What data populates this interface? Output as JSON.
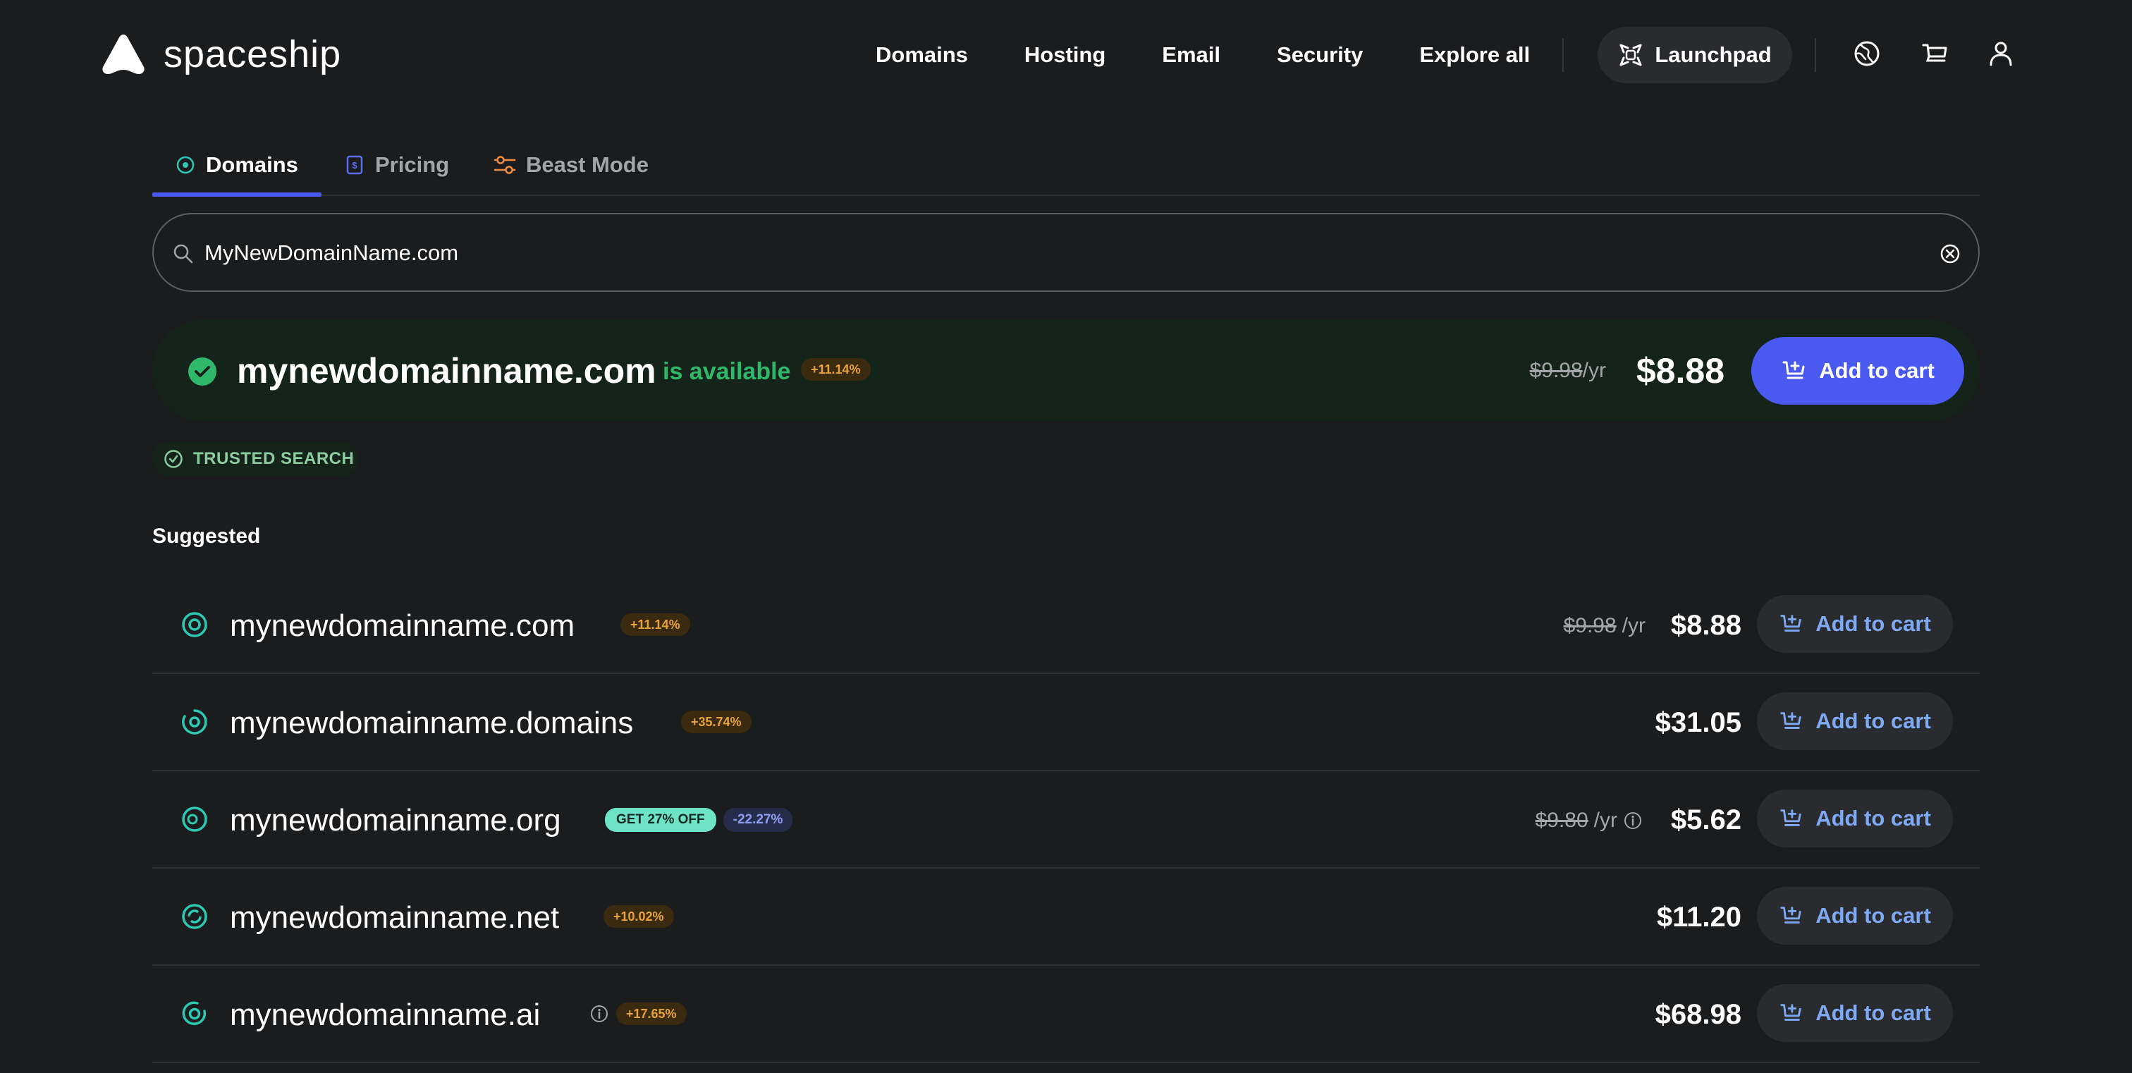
{
  "brand": {
    "name": "spaceship"
  },
  "nav": {
    "links": [
      "Domains",
      "Hosting",
      "Email",
      "Security",
      "Explore all"
    ],
    "launchpad": "Launchpad"
  },
  "tabs": [
    {
      "label": "Domains",
      "active": true
    },
    {
      "label": "Pricing",
      "active": false
    },
    {
      "label": "Beast Mode",
      "active": false
    }
  ],
  "search": {
    "value": "MyNewDomainName.com"
  },
  "featured": {
    "domain": "mynewdomainname.com",
    "status": "is available",
    "badge": "+11.14%",
    "old_price": "$9.98",
    "per": "/yr",
    "price": "$8.88",
    "cta": "Add to cart"
  },
  "trusted": "TRUSTED SEARCH",
  "suggested": {
    "heading": "Suggested",
    "rows": [
      {
        "domain": "mynewdomainname.com",
        "badge": "+11.14%",
        "old_price": "$9.98",
        "per": "/yr",
        "price": "$8.88",
        "cta": "Add to cart"
      },
      {
        "domain": "mynewdomainname.domains",
        "badge": "+35.74%",
        "price": "$31.05",
        "cta": "Add to cart"
      },
      {
        "domain": "mynewdomainname.org",
        "promo": "GET 27% OFF",
        "badge": "-22.27%",
        "old_price": "$9.80",
        "per": "/yr",
        "price": "$5.62",
        "cta": "Add to cart"
      },
      {
        "domain": "mynewdomainname.net",
        "badge": "+10.02%",
        "price": "$11.20",
        "cta": "Add to cart"
      },
      {
        "domain": "mynewdomainname.ai",
        "badge": "+17.65%",
        "price": "$68.98",
        "cta": "Add to cart"
      }
    ]
  },
  "colors": {
    "background": "#1b1c1e",
    "accent": "#4a5af0",
    "available_green": "#2fb869",
    "icon_teal": "#2ec9b3",
    "badge_orange": "#e8a23a"
  },
  "icons": [
    "rocket-logo-icon",
    "launchpad-icon",
    "globe-icon",
    "cart-icon",
    "user-icon",
    "domains-tab-icon",
    "pricing-tab-icon",
    "sliders-icon",
    "search-icon",
    "clear-icon",
    "check-circle-icon",
    "add-to-cart-icon",
    "tld-icon",
    "info-icon"
  ]
}
